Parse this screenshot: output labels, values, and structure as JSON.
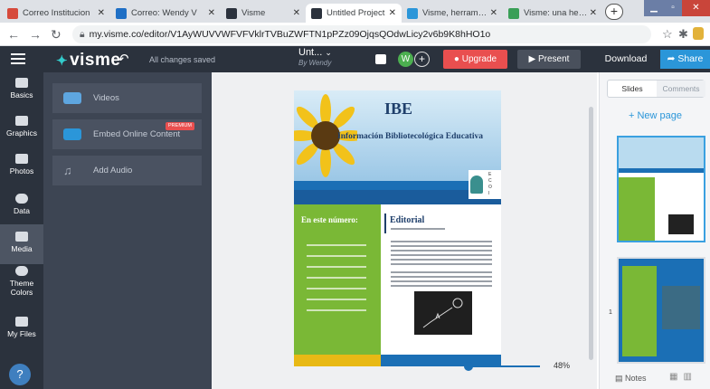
{
  "browser": {
    "tabs": [
      {
        "label": "Correo Institucion",
        "fav_color": "#d64a3b"
      },
      {
        "label": "Correo: Wendy V",
        "fav_color": "#1f6fc5"
      },
      {
        "label": "Visme",
        "fav_color": "#2b323d"
      },
      {
        "label": "Untitled Project",
        "fav_color": "#2b323d"
      },
      {
        "label": "Visme, herramien",
        "fav_color": "#2b96d9"
      },
      {
        "label": "Visme: una herra",
        "fav_color": "#3a9f57"
      }
    ],
    "new_tab": "+",
    "url": "my.visme.co/editor/V1AyWUVVWFVFVklrTVBuZWFTN1pPZz09OjqsQOdwLicy2v6b9K8hHO1o"
  },
  "app": {
    "logo": "visme",
    "save_status": "All changes saved",
    "project_title": "Unt...",
    "project_author": "By Wendy",
    "avatar_initial": "W",
    "upgrade_label": "Upgrade",
    "present_label": "Present",
    "download_label": "Download",
    "share_label": "Share"
  },
  "rail": {
    "items": [
      {
        "label": "Basics"
      },
      {
        "label": "Graphics"
      },
      {
        "label": "Photos"
      },
      {
        "label": "Data"
      },
      {
        "label": "Media"
      },
      {
        "label": "Theme Colors"
      },
      {
        "label": "My Files"
      }
    ],
    "help": "?"
  },
  "media_panel": {
    "videos": "Videos",
    "embed": "Embed Online Content",
    "premium_badge": "PREMIUM",
    "audio": "Add Audio"
  },
  "document": {
    "title": "IBE",
    "subtitle": "Información Bibliotecológica Educativa",
    "in_this_issue": "En este número:",
    "editorial": "Editorial",
    "ecoi": "E C O I"
  },
  "zoom": "48%",
  "slides_panel": {
    "tab_slides": "Slides",
    "tab_comments": "Comments",
    "new_page": "+ New page",
    "slide_number": "1",
    "notes": "Notes"
  }
}
